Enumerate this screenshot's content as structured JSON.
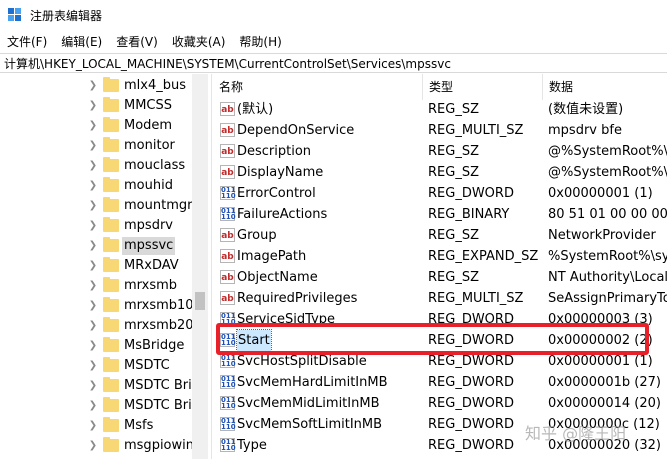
{
  "window": {
    "title": "注册表编辑器"
  },
  "menu": [
    "文件(F)",
    "编辑(E)",
    "查看(V)",
    "收藏夹(A)",
    "帮助(H)"
  ],
  "address": "计算机\\HKEY_LOCAL_MACHINE\\SYSTEM\\CurrentControlSet\\Services\\mpssvc",
  "tree": [
    {
      "label": "mlx4_bus",
      "selected": false
    },
    {
      "label": "MMCSS",
      "selected": false
    },
    {
      "label": "Modem",
      "selected": false
    },
    {
      "label": "monitor",
      "selected": false
    },
    {
      "label": "mouclass",
      "selected": false
    },
    {
      "label": "mouhid",
      "selected": false
    },
    {
      "label": "mountmgr",
      "selected": false
    },
    {
      "label": "mpsdrv",
      "selected": false
    },
    {
      "label": "mpssvc",
      "selected": true
    },
    {
      "label": "MRxDAV",
      "selected": false
    },
    {
      "label": "mrxsmb",
      "selected": false
    },
    {
      "label": "mrxsmb10",
      "selected": false
    },
    {
      "label": "mrxsmb20",
      "selected": false
    },
    {
      "label": "MsBridge",
      "selected": false
    },
    {
      "label": "MSDTC",
      "selected": false
    },
    {
      "label": "MSDTC Brid",
      "selected": false
    },
    {
      "label": "MSDTC Brid",
      "selected": false
    },
    {
      "label": "Msfs",
      "selected": false
    },
    {
      "label": "msgpiowin3",
      "selected": false
    }
  ],
  "columns": {
    "name": "名称",
    "type": "类型",
    "data": "数据"
  },
  "values": [
    {
      "name": "(默认)",
      "type": "REG_SZ",
      "data": "(数值未设置)",
      "icon": "string-value-icon"
    },
    {
      "name": "DependOnService",
      "type": "REG_MULTI_SZ",
      "data": "mpsdrv bfe",
      "icon": "string-value-icon"
    },
    {
      "name": "Description",
      "type": "REG_SZ",
      "data": "@%SystemRoot%\\sy",
      "icon": "string-value-icon"
    },
    {
      "name": "DisplayName",
      "type": "REG_SZ",
      "data": "@%SystemRoot%\\sy",
      "icon": "string-value-icon"
    },
    {
      "name": "ErrorControl",
      "type": "REG_DWORD",
      "data": "0x00000001 (1)",
      "icon": "binary-value-icon"
    },
    {
      "name": "FailureActions",
      "type": "REG_BINARY",
      "data": "80 51 01 00 00 00 00",
      "icon": "binary-value-icon"
    },
    {
      "name": "Group",
      "type": "REG_SZ",
      "data": "NetworkProvider",
      "icon": "string-value-icon"
    },
    {
      "name": "ImagePath",
      "type": "REG_EXPAND_SZ",
      "data": "%SystemRoot%\\syst",
      "icon": "string-value-icon"
    },
    {
      "name": "ObjectName",
      "type": "REG_SZ",
      "data": "NT Authority\\LocalSe",
      "icon": "string-value-icon"
    },
    {
      "name": "RequiredPrivileges",
      "type": "REG_MULTI_SZ",
      "data": "SeAssignPrimaryToke",
      "icon": "string-value-icon"
    },
    {
      "name": "ServiceSidType",
      "type": "REG_DWORD",
      "data": "0x00000003 (3)",
      "icon": "binary-value-icon"
    },
    {
      "name": "Start",
      "type": "REG_DWORD",
      "data": "0x00000002 (2)",
      "icon": "binary-value-icon",
      "highlight": true
    },
    {
      "name": "SvcHostSplitDisable",
      "type": "REG_DWORD",
      "data": "0x00000001 (1)",
      "icon": "binary-value-icon"
    },
    {
      "name": "SvcMemHardLimitInMB",
      "type": "REG_DWORD",
      "data": "0x0000001b (27)",
      "icon": "binary-value-icon"
    },
    {
      "name": "SvcMemMidLimitInMB",
      "type": "REG_DWORD",
      "data": "0x00000014 (20)",
      "icon": "binary-value-icon"
    },
    {
      "name": "SvcMemSoftLimitInMB",
      "type": "REG_DWORD",
      "data": "0x0000000c (12)",
      "icon": "binary-value-icon"
    },
    {
      "name": "Type",
      "type": "REG_DWORD",
      "data": "0x00000020 (32)",
      "icon": "binary-value-icon"
    }
  ],
  "watermark": "知乎 @隆王阳"
}
